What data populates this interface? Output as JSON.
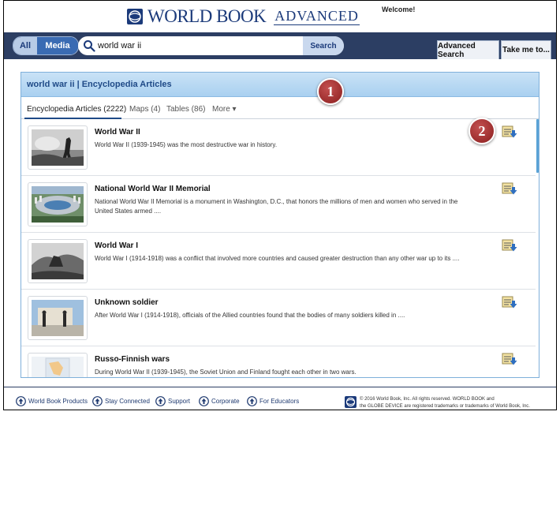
{
  "header": {
    "logo_text": "WORLD BOOK",
    "logo_edition": "ADVANCED",
    "welcome": "Welcome!"
  },
  "nav": {
    "all_label": "All",
    "media_label": "Media",
    "search_value": "world war ii",
    "search_button": "Search",
    "advanced_search": "Advanced Search",
    "take_me_to": "Take me to..."
  },
  "panel": {
    "title": "world war ii | Encyclopedia Articles",
    "tabs": {
      "articles": "Encyclopedia Articles (2222)",
      "maps": "Maps (4)",
      "tables": "Tables (86)",
      "more": "More ▾"
    }
  },
  "results": [
    {
      "title": "World War II",
      "description": "World War II (1939-1945) was the most destructive war in history."
    },
    {
      "title": "National World War II Memorial",
      "description": "National World War II Memorial is a monument in Washington, D.C., that honors the millions of men and women who served in the United States armed ...."
    },
    {
      "title": "World War I",
      "description": "World War I (1914-1918) was a conflict that involved more countries and caused greater destruction than any other war up to its ...."
    },
    {
      "title": "Unknown soldier",
      "description": "After World War I (1914-1918), officials of the Allied countries found that the bodies of many soldiers killed in ...."
    },
    {
      "title": "Russo-Finnish wars",
      "description": "During World War II (1939-1945), the Soviet Union and Finland fought each other in two wars."
    }
  ],
  "markers": {
    "one": "1",
    "two": "2"
  },
  "footer": {
    "links": [
      "World Book Products",
      "Stay Connected",
      "Support",
      "Corporate",
      "For Educators"
    ],
    "copyright_line1": "© 2016 World Book, Inc. All rights reserved. WORLD BOOK and",
    "copyright_line2": "the GLOBE DEVICE are registered trademarks or trademarks of World Book, Inc."
  },
  "colors": {
    "nav_bar": "#2c3e63",
    "panel_header": "#a9d0f0",
    "brand": "#1b3a7a",
    "marker": "#8a1e1e"
  }
}
